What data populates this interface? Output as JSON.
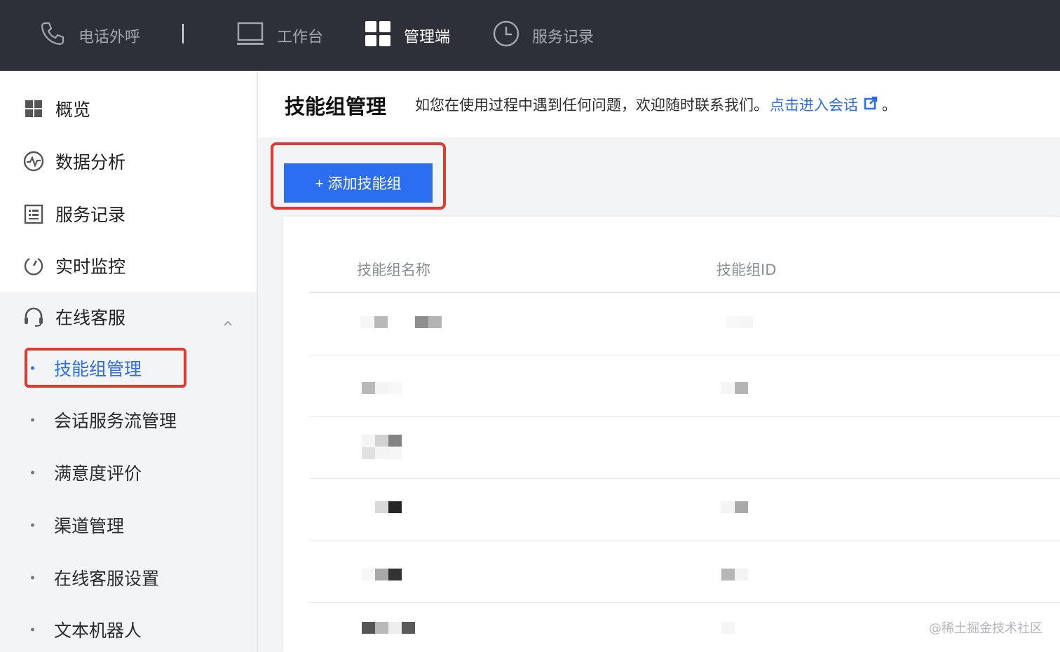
{
  "topbar": {
    "items": [
      {
        "label": "电话外呼",
        "icon": "phone-icon"
      },
      {
        "label": "工作台",
        "icon": "monitor-icon"
      },
      {
        "label": "管理端",
        "icon": "grid-icon",
        "active": true
      },
      {
        "label": "服务记录",
        "icon": "clock-icon"
      }
    ]
  },
  "sidebar": {
    "items": [
      {
        "label": "概览",
        "icon": "dashboard-icon"
      },
      {
        "label": "数据分析",
        "icon": "analytics-icon"
      },
      {
        "label": "服务记录",
        "icon": "record-icon"
      },
      {
        "label": "实时监控",
        "icon": "monitor-gauge-icon"
      },
      {
        "label": "在线客服",
        "icon": "headset-icon",
        "expanded": true
      }
    ],
    "subitems": [
      {
        "label": "技能组管理",
        "active": true
      },
      {
        "label": "会话服务流管理"
      },
      {
        "label": "满意度评价"
      },
      {
        "label": "渠道管理"
      },
      {
        "label": "在线客服设置"
      },
      {
        "label": "文本机器人"
      }
    ]
  },
  "main": {
    "title": "技能组管理",
    "notice_text": "如您在使用过程中遇到任何问题，欢迎随时联系我们。",
    "notice_link": "点击进入会话",
    "notice_end": "。",
    "add_button": "+ 添加技能组",
    "table": {
      "columns": [
        "技能组名称",
        "技能组ID"
      ],
      "rows": 6
    }
  },
  "watermark": "@稀土掘金技术社区",
  "colors": {
    "topbar_bg": "#2d3038",
    "accent": "#2b6ef0",
    "highlight_red": "#e3392f",
    "page_bg": "#f3f4f6"
  }
}
